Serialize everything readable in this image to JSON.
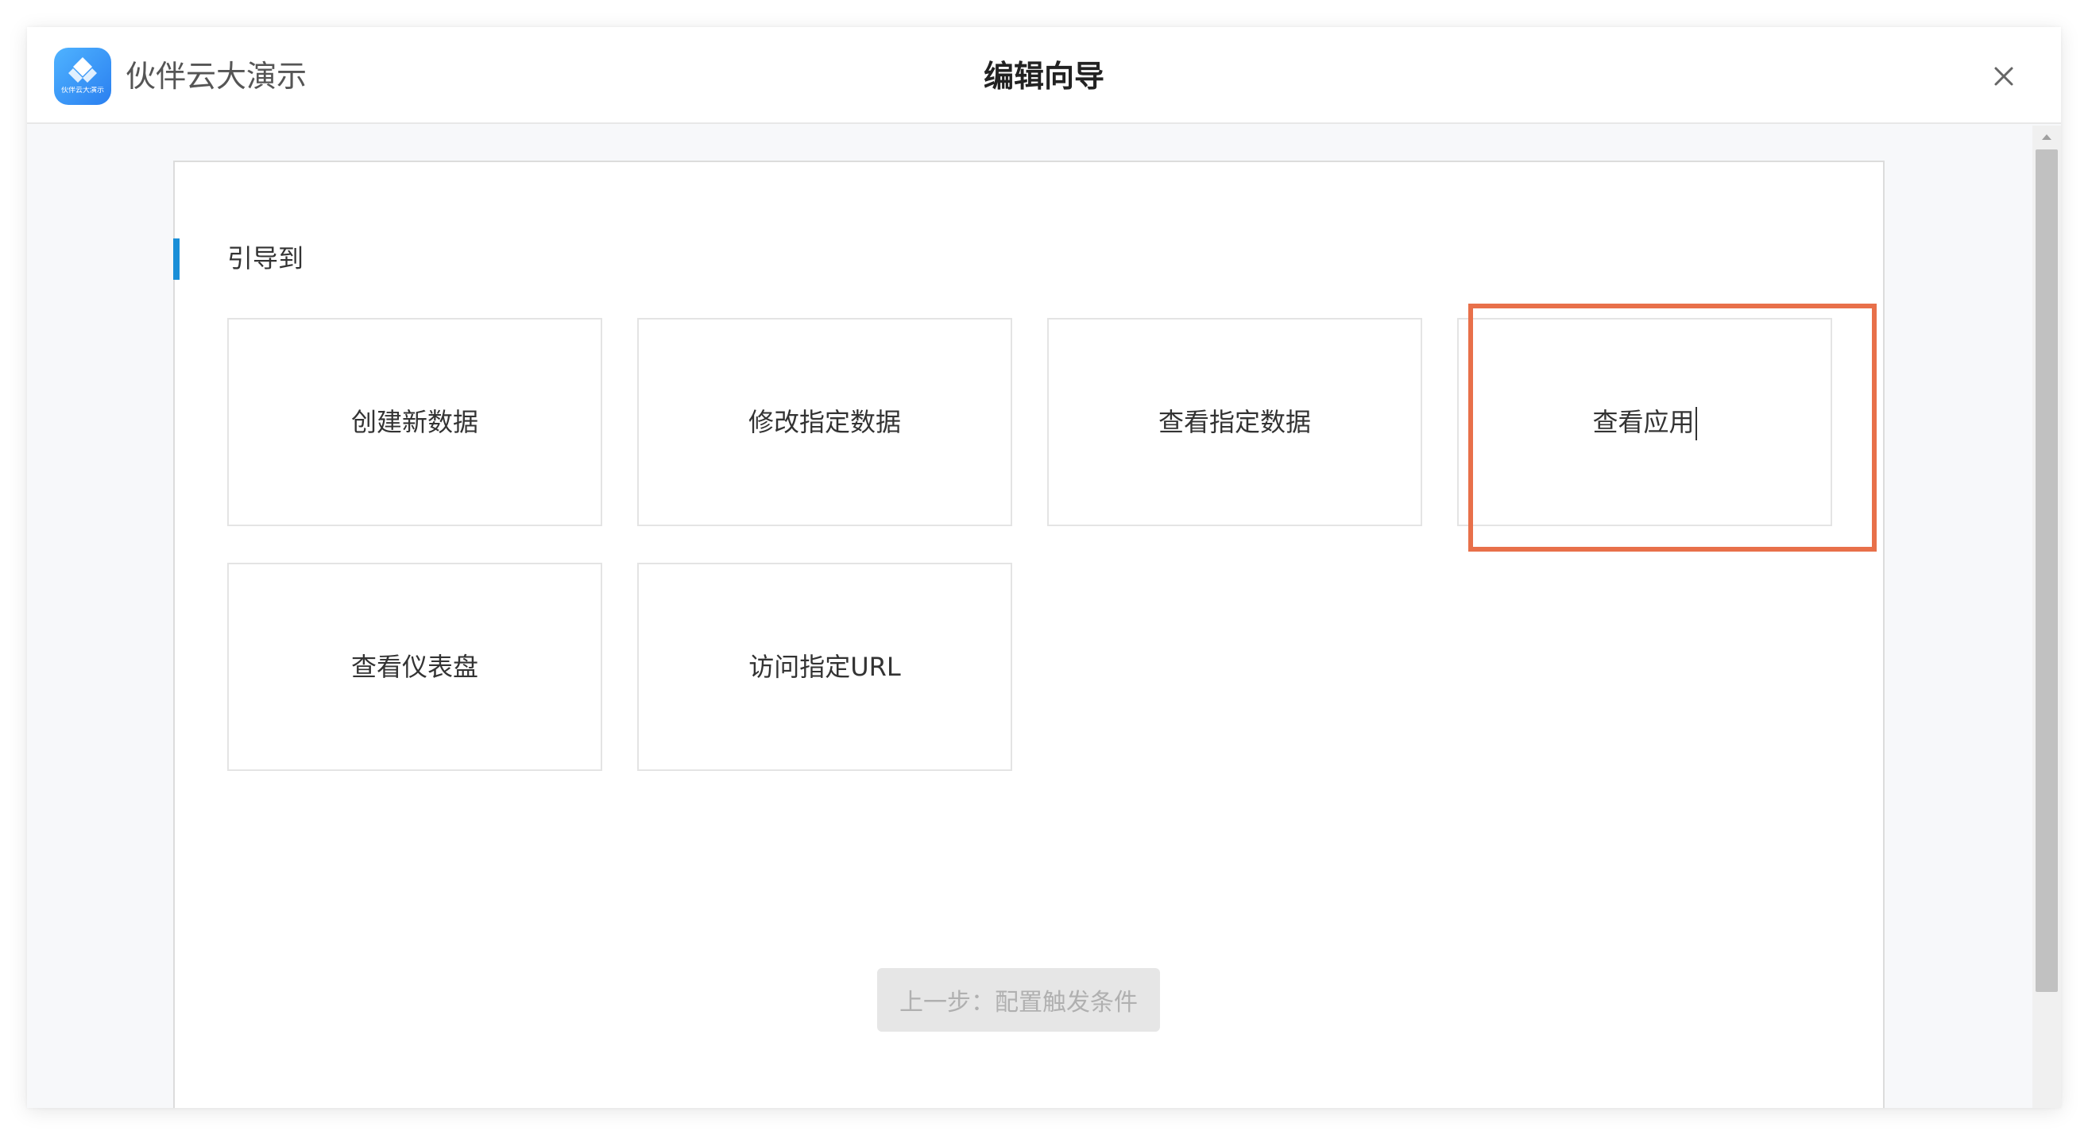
{
  "app": {
    "name": "伙伴云大演示",
    "logo_subtext": "伙伴云大演示",
    "brand_color": "#2a8df2"
  },
  "dialog": {
    "title": "编辑向导",
    "close_icon": "close-icon"
  },
  "section": {
    "title": "引导到",
    "accent_color": "#1a8fd8"
  },
  "options": [
    {
      "label": "创建新数据",
      "selected": false
    },
    {
      "label": "修改指定数据",
      "selected": false
    },
    {
      "label": "查看指定数据",
      "selected": false
    },
    {
      "label": "查看应用",
      "selected": true
    },
    {
      "label": "查看仪表盘",
      "selected": false
    },
    {
      "label": "访问指定URL",
      "selected": false
    }
  ],
  "selection_color": "#e8704a",
  "footer": {
    "prev_label": "上一步：配置触发条件"
  }
}
